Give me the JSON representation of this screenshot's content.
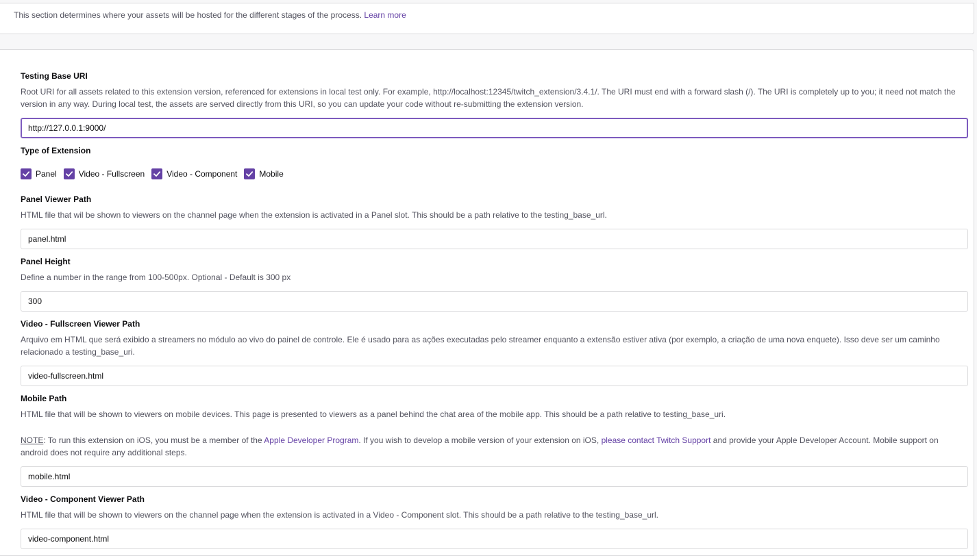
{
  "intro": {
    "text": "This section determines where your assets will be hosted for the different stages of the process.",
    "learn_more": "Learn more"
  },
  "testing_base_uri": {
    "title": "Testing Base URI",
    "description": "Root URI for all assets related to this extension version, referenced for extensions in local test only. For example, http://localhost:12345/twitch_extension/3.4.1/. The URI must end with a forward slash (/). The URI is completely up to you; it need not match the version in any way. During local test, the assets are served directly from this URI, so you can update your code without re-submitting the extension version.",
    "value": "http://127.0.0.1:9000/"
  },
  "type_of_extension": {
    "title": "Type of Extension",
    "options": [
      {
        "label": "Panel",
        "checked": true
      },
      {
        "label": "Video - Fullscreen",
        "checked": true
      },
      {
        "label": "Video - Component",
        "checked": true
      },
      {
        "label": "Mobile",
        "checked": true
      }
    ]
  },
  "panel_viewer_path": {
    "title": "Panel Viewer Path",
    "description": "HTML file that wil be shown to viewers on the channel page when the extension is activated in a Panel slot. This should be a path relative to the testing_base_url.",
    "value": "panel.html"
  },
  "panel_height": {
    "title": "Panel Height",
    "description": "Define a number in the range from 100-500px. Optional - Default is 300 px",
    "value": "300"
  },
  "video_fullscreen_viewer_path": {
    "title": "Video - Fullscreen Viewer Path",
    "description": "Arquivo em HTML que será exibido a streamers no módulo ao vivo do painel de controle. Ele é usado para as ações executadas pelo streamer enquanto a extensão estiver ativa (por exemplo, a criação de uma nova enquete). Isso deve ser um caminho relacionado a testing_base_uri.",
    "value": "video-fullscreen.html"
  },
  "mobile_path": {
    "title": "Mobile Path",
    "description": "HTML file that will be shown to viewers on mobile devices. This page is presented to viewers as a panel behind the chat area of the mobile app. This should be a path relative to testing_base_uri.",
    "note_label": "NOTE",
    "note_part1": ": To run this extension on iOS, you must be a member of the ",
    "note_link1": "Apple Developer Program",
    "note_part2": ". If you wish to develop a mobile version of your extension on iOS, ",
    "note_link2": "please contact Twitch Support",
    "note_part3": " and provide your Apple Developer Account. Mobile support on android does not require any additional steps.",
    "value": "mobile.html"
  },
  "video_component_viewer_path": {
    "title": "Video - Component Viewer Path",
    "description": "HTML file that will be shown to viewers on the channel page when the extension is activated in a Video - Component slot. This should be a path relative to the testing_base_url.",
    "value": "video-component.html"
  },
  "colors": {
    "accent": "#6441a5",
    "focus_border": "#7d5bbe",
    "muted_text": "#53535f"
  }
}
